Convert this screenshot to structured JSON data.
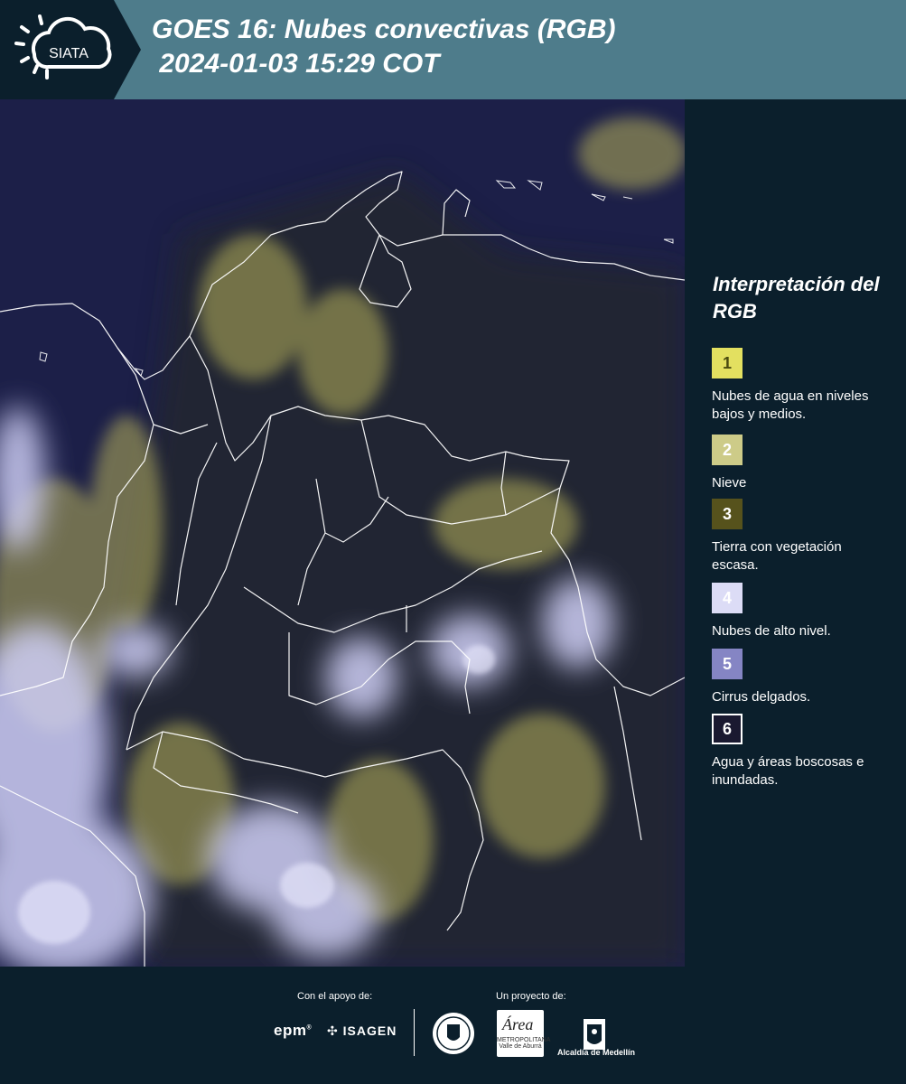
{
  "header": {
    "logo_text": "SIATA",
    "title_line1": "GOES 16: Nubes convectivas (RGB)",
    "title_line2": " 2024-01-03 15:29 COT"
  },
  "legend": {
    "title": "Interpretación del RGB",
    "items": [
      {
        "number": "1",
        "label": "Nubes de agua en niveles bajos y medios.",
        "color": "#e3e060",
        "text_color": "#4a4a10",
        "border": "#e3e060"
      },
      {
        "number": "2",
        "label": "Nieve",
        "color": "#cdcb88",
        "text_color": "#ffffff",
        "border": "#cdcb88"
      },
      {
        "number": "3",
        "label": "Tierra con vegetación escasa.",
        "color": "#56521c",
        "text_color": "#ffffff",
        "border": "#56521c"
      },
      {
        "number": "4",
        "label": "Nubes de alto nivel.",
        "color": "#dcdcf6",
        "text_color": "#ffffff",
        "border": "#dcdcf6"
      },
      {
        "number": "5",
        "label": "Cirrus delgados.",
        "color": "#8585c4",
        "text_color": "#ffffff",
        "border": "#8585c4"
      },
      {
        "number": "6",
        "label": "Agua y áreas boscosas e inundadas.",
        "color": "#1a1930",
        "text_color": "#ffffff",
        "border": "#ffffff"
      }
    ]
  },
  "footer": {
    "support_label": "Con el apoyo de:",
    "project_label": "Un proyecto de:",
    "sponsor_1": "epm",
    "sponsor_2": "ISAGEN",
    "area_text": "Área",
    "area_subtext": "METROPOLITANA Valle de Aburrá",
    "alcaldia": "Alcaldía de Medellín"
  },
  "colors": {
    "background": "#0b1f2c",
    "header_band": "#4e7c8b",
    "map_base": "#1c1f48",
    "low_clouds": "#d8d070",
    "high_clouds": "#c9c9f2"
  }
}
